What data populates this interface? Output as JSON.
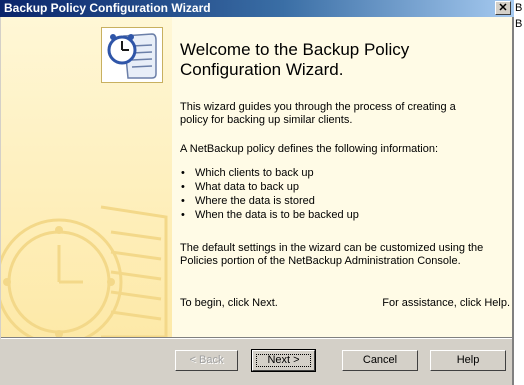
{
  "window": {
    "title": "Backup Policy Configuration Wizard",
    "close_glyph": "✕"
  },
  "edge_glyph": "B",
  "wizard": {
    "heading_line1": "Welcome to the Backup Policy",
    "heading_line2": "Configuration Wizard.",
    "intro_line1": "This wizard guides you through the process of creating a",
    "intro_line2": "policy for backing up similar clients.",
    "defines": "A NetBackup policy defines the following information:",
    "bullets": [
      "Which clients to back up",
      "What data to back up",
      "Where the data is stored",
      "When the data is to be backed up"
    ],
    "customize_line1": "The default settings in the wizard can be customized using the",
    "customize_line2": "Policies portion of the NetBackup Administration Console.",
    "begin_text": "To begin, click Next.",
    "help_text": "For assistance, click Help."
  },
  "buttons": {
    "back": "< Back",
    "next": "Next >",
    "cancel": "Cancel",
    "help": "Help"
  },
  "icons": {
    "wizard": "clock-document-icon",
    "watermark": "clock-watermark-icon"
  },
  "colors": {
    "titlebar_start": "#0a246a",
    "titlebar_end": "#a6caf0",
    "panel_bg": "#fffbe6",
    "button_face": "#d4d0c8"
  }
}
